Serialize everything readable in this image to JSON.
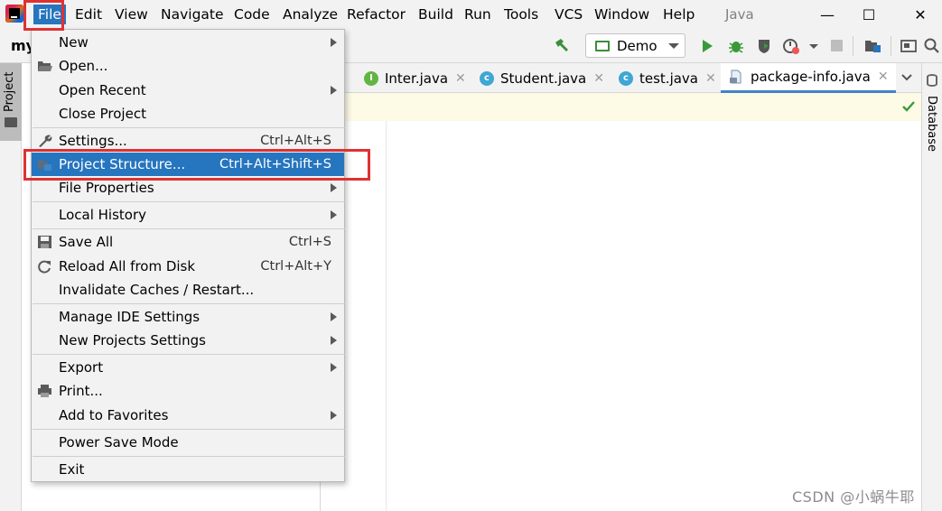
{
  "menubar": {
    "items": [
      "File",
      "Edit",
      "View",
      "Navigate",
      "Code",
      "Analyze",
      "Refactor",
      "Build",
      "Run",
      "Tools",
      "VCS",
      "Window",
      "Help"
    ],
    "active": "File",
    "window_title": "Java"
  },
  "window_controls": {
    "minimize": "—",
    "maximize": "☐",
    "close": "✕"
  },
  "navbar": {
    "project_name": "my",
    "run_config": "Demo"
  },
  "left_toolwindow": {
    "project_label": "Project"
  },
  "right_toolwindow": {
    "database_label": "Database"
  },
  "editor_tabs": [
    {
      "label": "Inter.java",
      "icon": "I",
      "icon_color": "#62b543",
      "selected": false
    },
    {
      "label": "Student.java",
      "icon": "c",
      "icon_color": "#3ea7d4",
      "selected": false
    },
    {
      "label": "test.java",
      "icon": "c",
      "icon_color": "#3ea7d4",
      "selected": false
    },
    {
      "label": "package-info.java",
      "icon": "file",
      "icon_color": "#7a8ea8",
      "selected": true
    }
  ],
  "file_menu": {
    "items": [
      {
        "label": "New",
        "submenu": true,
        "icon": ""
      },
      {
        "label": "Open...",
        "icon": "folder-icon"
      },
      {
        "label": "Open Recent",
        "submenu": true
      },
      {
        "label": "Close Project"
      },
      {
        "label": "Settings...",
        "shortcut": "Ctrl+Alt+S",
        "icon": "wrench-icon"
      },
      {
        "label": "Project Structure...",
        "shortcut": "Ctrl+Alt+Shift+S",
        "icon": "project-structure-icon",
        "selected": true
      },
      {
        "label": "File Properties",
        "submenu": true
      },
      {
        "label": "Local History",
        "submenu": true
      },
      {
        "label": "Save All",
        "shortcut": "Ctrl+S",
        "icon": "save-icon"
      },
      {
        "label": "Reload All from Disk",
        "shortcut": "Ctrl+Alt+Y",
        "icon": "reload-icon"
      },
      {
        "label": "Invalidate Caches / Restart..."
      },
      {
        "label": "Manage IDE Settings",
        "submenu": true
      },
      {
        "label": "New Projects Settings",
        "submenu": true
      },
      {
        "label": "Export",
        "submenu": true
      },
      {
        "label": "Print...",
        "icon": "print-icon"
      },
      {
        "label": "Add to Favorites",
        "submenu": true
      },
      {
        "label": "Power Save Mode"
      },
      {
        "label": "Exit"
      }
    ]
  },
  "watermark": "CSDN @小蜗牛耶",
  "colors": {
    "accent": "#2675bf",
    "highlight_box": "#e03131",
    "run_green": "#3a8e3a"
  }
}
